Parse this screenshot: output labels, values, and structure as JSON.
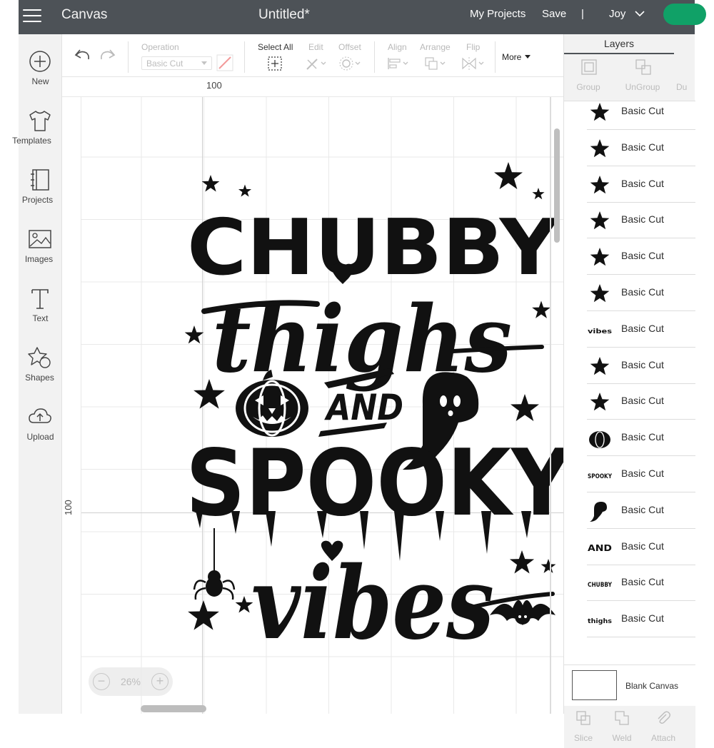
{
  "topbar": {
    "app_title": "Canvas",
    "doc_title": "Untitled*",
    "my_projects": "My Projects",
    "save": "Save",
    "separator": "|",
    "user": "Joy",
    "accent": "#10a167"
  },
  "sidebar": {
    "items": [
      {
        "label": "New",
        "icon": "plus-circle-icon"
      },
      {
        "label": "Templates",
        "icon": "tshirt-icon"
      },
      {
        "label": "Projects",
        "icon": "projects-icon"
      },
      {
        "label": "Images",
        "icon": "image-icon"
      },
      {
        "label": "Text",
        "icon": "text-icon"
      },
      {
        "label": "Shapes",
        "icon": "shapes-icon"
      },
      {
        "label": "Upload",
        "icon": "upload-cloud-icon"
      }
    ]
  },
  "toolbar": {
    "operation_label": "Operation",
    "operation_value": "Basic Cut",
    "select_all": "Select All",
    "edit": "Edit",
    "offset": "Offset",
    "align": "Align",
    "arrange": "Arrange",
    "flip": "Flip",
    "more": "More"
  },
  "rulers": {
    "top_mark": "100",
    "left_mark": "100"
  },
  "canvas": {
    "artwork_text": [
      "CHUBBY",
      "thighs",
      "AND",
      "SPOOKY",
      "vibes"
    ]
  },
  "zoom": {
    "value": "26%",
    "minus": "−",
    "plus": "+"
  },
  "layers": {
    "title": "Layers",
    "actions": [
      {
        "label": "Group",
        "icon": "group-icon"
      },
      {
        "label": "UnGroup",
        "icon": "ungroup-icon"
      },
      {
        "label": "Du",
        "icon": "duplicate-icon"
      }
    ],
    "rows": [
      {
        "name": "Basic Cut",
        "thumb": "star"
      },
      {
        "name": "Basic Cut",
        "thumb": "star"
      },
      {
        "name": "Basic Cut",
        "thumb": "star"
      },
      {
        "name": "Basic Cut",
        "thumb": "star"
      },
      {
        "name": "Basic Cut",
        "thumb": "star"
      },
      {
        "name": "Basic Cut",
        "thumb": "star"
      },
      {
        "name": "Basic Cut",
        "thumb": "vibes",
        "thumb_text": "vibes"
      },
      {
        "name": "Basic Cut",
        "thumb": "star"
      },
      {
        "name": "Basic Cut",
        "thumb": "star"
      },
      {
        "name": "Basic Cut",
        "thumb": "pumpkin"
      },
      {
        "name": "Basic Cut",
        "thumb": "spooky",
        "thumb_text": "SPOOKY"
      },
      {
        "name": "Basic Cut",
        "thumb": "ghost"
      },
      {
        "name": "Basic Cut",
        "thumb": "and",
        "thumb_text": "AND"
      },
      {
        "name": "Basic Cut",
        "thumb": "chubby",
        "thumb_text": "CHUBBY"
      },
      {
        "name": "Basic Cut",
        "thumb": "thighs",
        "thumb_text": "thighs"
      }
    ],
    "blank_canvas": "Blank Canvas",
    "bottom_actions": [
      {
        "label": "Slice",
        "icon": "slice-icon"
      },
      {
        "label": "Weld",
        "icon": "weld-icon"
      },
      {
        "label": "Attach",
        "icon": "attach-icon"
      }
    ]
  }
}
